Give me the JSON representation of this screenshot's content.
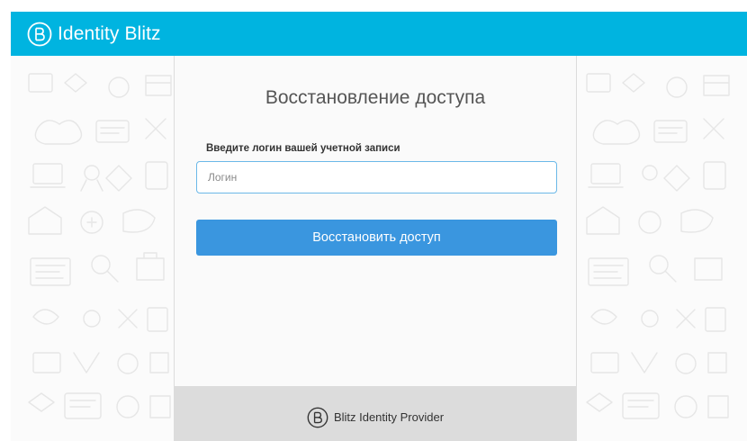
{
  "header": {
    "brand_name": "Identity Blitz",
    "logo_icon": "blitz-b-logo-icon",
    "background_color": "#00b4e0"
  },
  "card": {
    "title": "Восстановление доступа",
    "field_label": "Введите логин вашей учетной записи",
    "login_input": {
      "value": "",
      "placeholder": "Логин"
    },
    "submit_label": "Восстановить доступ",
    "button_color": "#3a96df"
  },
  "footer": {
    "logo_icon": "blitz-b-logo-icon",
    "text": "Blitz Identity Provider"
  }
}
